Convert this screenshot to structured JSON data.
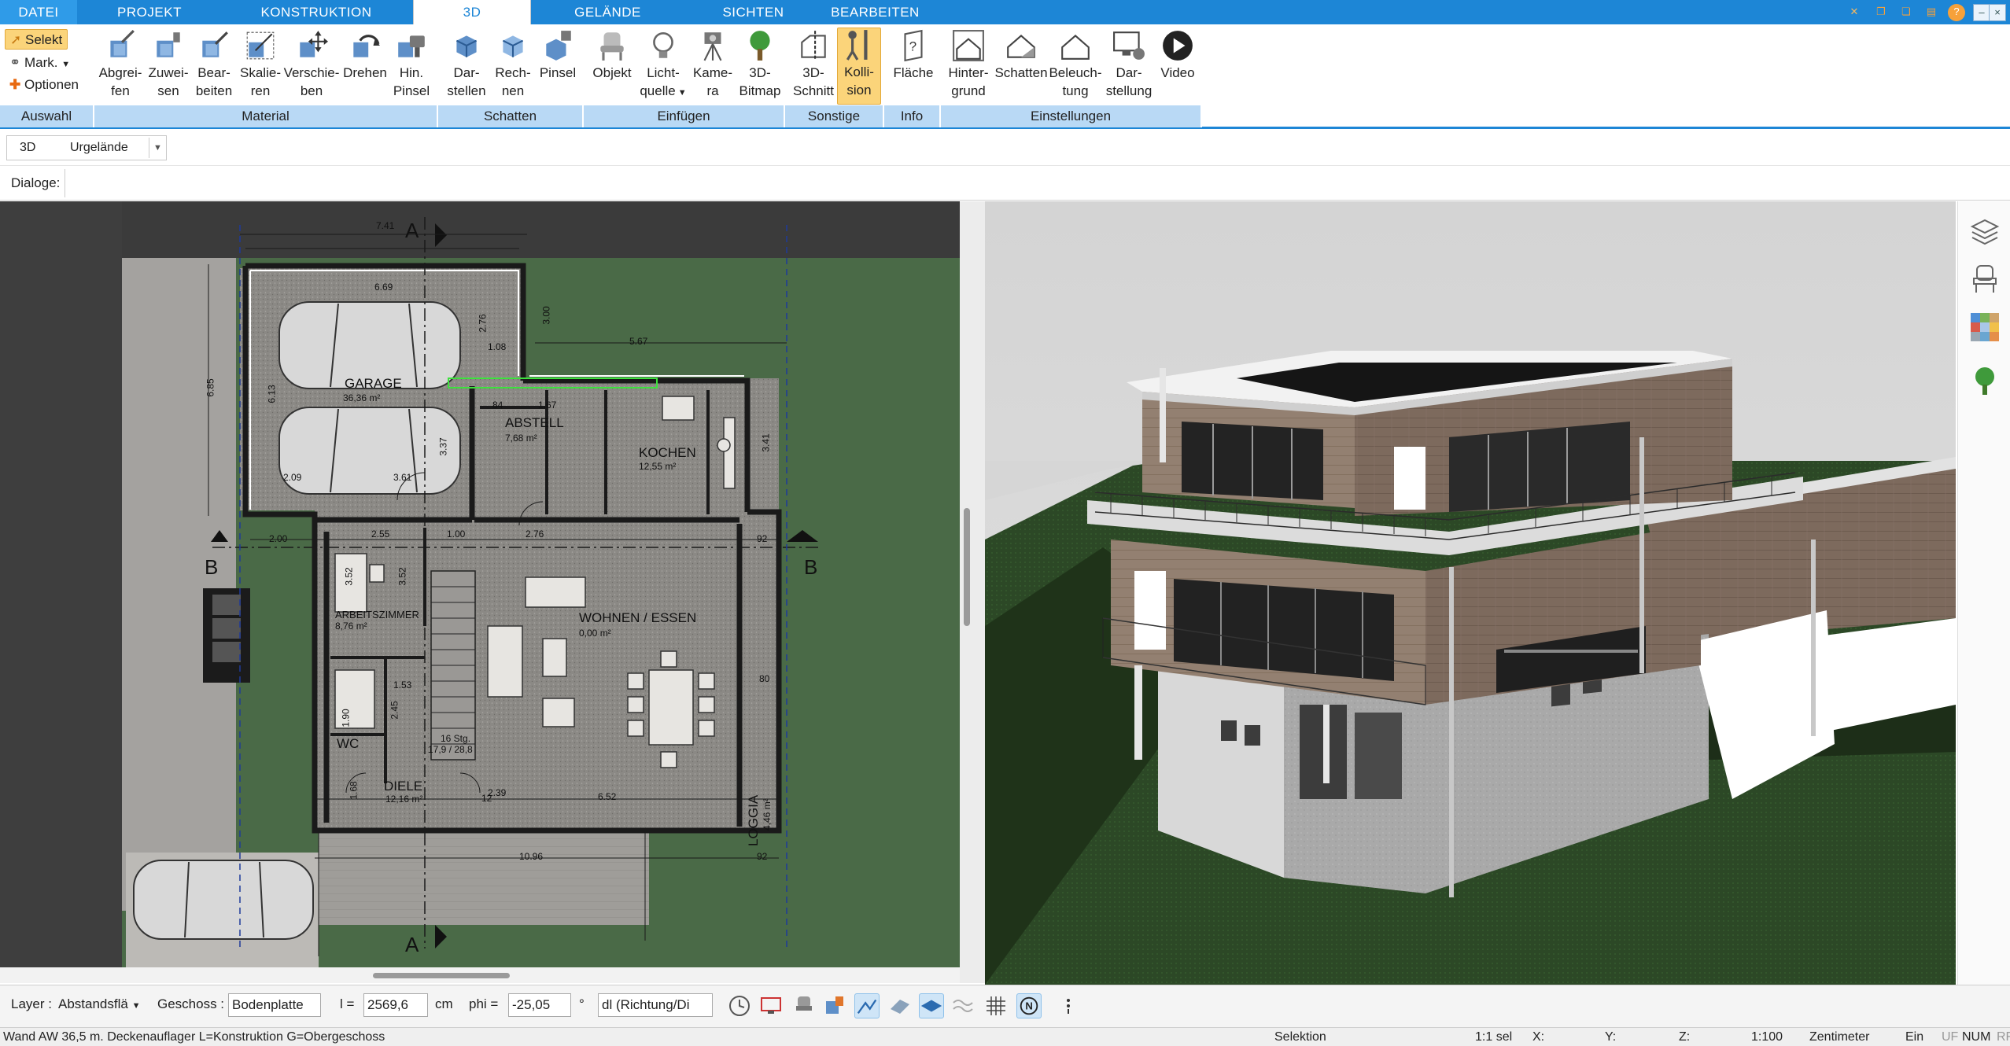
{
  "tabs": [
    "DATEI",
    "PROJEKT",
    "KONSTRUKTION",
    "3D",
    "GELÄNDE",
    "SICHTEN",
    "BEARBEITEN"
  ],
  "active_tab": "3D",
  "window_controls": [
    "settings",
    "restore",
    "maximize",
    "help",
    "minimize",
    "maximize",
    "close"
  ],
  "auswahl": {
    "selekt": "Selekt",
    "mark": "Mark.",
    "optionen": "Optionen",
    "label": "Auswahl"
  },
  "groups": {
    "material": "Material",
    "schatten": "Schatten",
    "einfuegen": "Einfügen",
    "sonstige": "Sonstige",
    "info": "Info",
    "einstellungen": "Einstellungen"
  },
  "buttons": {
    "abgreifen": [
      "Abgrei-",
      "fen"
    ],
    "zuweisen": [
      "Zuwei-",
      "sen"
    ],
    "bearbeiten": [
      "Bear-",
      "beiten"
    ],
    "skalieren": [
      "Skalie-",
      "ren"
    ],
    "verschieben": [
      "Verschie-",
      "ben"
    ],
    "drehen": [
      "Drehen",
      ""
    ],
    "hinpinsel": [
      "Hin.",
      "Pinsel"
    ],
    "darstellen": [
      "Dar-",
      "stellen"
    ],
    "rechnen": [
      "Rech-",
      "nen"
    ],
    "pinsel": [
      "Pinsel",
      ""
    ],
    "objekt": [
      "Objekt",
      ""
    ],
    "lichtquelle": [
      "Licht-",
      "quelle"
    ],
    "kamera": [
      "Kame-",
      "ra"
    ],
    "bitmap3d": [
      "3D-",
      "Bitmap"
    ],
    "schnitt3d": [
      "3D-",
      "Schnitt"
    ],
    "kollision": [
      "Kolli-",
      "sion"
    ],
    "flaeche": [
      "Fläche",
      ""
    ],
    "hintergrund": [
      "Hinter-",
      "grund"
    ],
    "schattenbtn": [
      "Schatten",
      ""
    ],
    "beleuchtung": [
      "Beleuch-",
      "tung"
    ],
    "darstellung": [
      "Dar-",
      "stellung"
    ],
    "video": [
      "Video",
      ""
    ]
  },
  "option_row": {
    "mode": "3D",
    "terrain": "Urgelände"
  },
  "dialoge_label": "Dialoge:",
  "plan": {
    "rooms": [
      {
        "name": "GARAGE",
        "area": "36,36 m²"
      },
      {
        "name": "ABSTELL",
        "area": "7,68 m²"
      },
      {
        "name": "KOCHEN",
        "area": "12,55 m²"
      },
      {
        "name": "ARBEITSZIMMER",
        "area": "8,76 m²"
      },
      {
        "name": "WOHNEN / ESSEN",
        "area": "0,00 m²"
      },
      {
        "name": "LOGGIA",
        "area": "4,46 m²"
      },
      {
        "name": "WC",
        "area": ""
      },
      {
        "name": "DIELE",
        "area": "12,16 m²"
      }
    ],
    "section_marks": [
      "A",
      "A",
      "B",
      "B"
    ],
    "dims": [
      "7.41",
      "6.69",
      "5.67",
      "1.08",
      "2.76",
      "3.00",
      "6.85",
      "6.13",
      "3.37",
      "2.09",
      "3.61",
      "1.67",
      "84",
      "3.41",
      "2.00",
      "2.55",
      "1.00",
      "2.76",
      "92",
      "3.52",
      "3.52",
      "6.52",
      "10.96",
      "92",
      "1.53",
      "2.45",
      "1.90",
      "1.68",
      "2.39",
      "80",
      "16 Stg.",
      "17,9 / 28,8",
      "12"
    ]
  },
  "bottom": {
    "layer_label": "Layer :",
    "layer_value": "Abstandsflä",
    "geschoss_label": "Geschoss :",
    "geschoss_value": "Bodenplatte",
    "l_label": "l =",
    "l_value": "2569,6",
    "l_unit": "cm",
    "phi_label": "phi =",
    "phi_value": "-25,05",
    "phi_unit": "°",
    "dl_value": "dl (Richtung/Di"
  },
  "status": {
    "message": "Wand AW 36,5 m. Deckenauflager L=Konstruktion G=Obergeschoss",
    "mode": "Selektion",
    "sel": "1:1 sel",
    "x": "X:",
    "y": "Y:",
    "z": "Z:",
    "scale": "1:100",
    "unit": "Zentimeter",
    "ein": "Ein",
    "uf": "UF",
    "num": "NUM",
    "rf": "RF"
  },
  "colors": {
    "accent": "#1d86d6",
    "ribbon_group": "#b9d9f5",
    "highlight": "#fbd47a",
    "plan_ground": "#415e40",
    "floor": "#8e8c88",
    "sky": "#d6d6d6",
    "lawn": "#2f4a26"
  }
}
